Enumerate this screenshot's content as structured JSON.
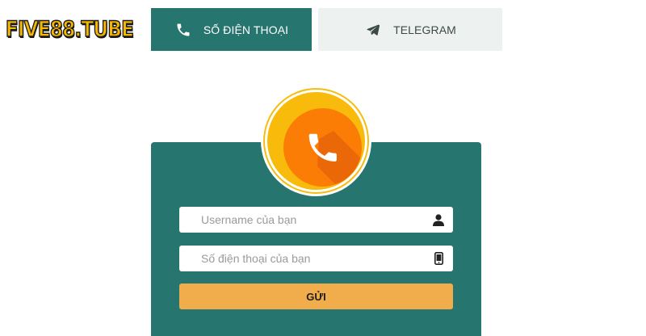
{
  "brand": {
    "logo_text": "FIVE88.TUBE"
  },
  "tabs": [
    {
      "label": "SỐ ĐIỆN THOẠI",
      "icon": "phone-icon",
      "active": true
    },
    {
      "label": "TELEGRAM",
      "icon": "telegram-icon",
      "active": false
    }
  ],
  "badge": {
    "icon": "phone-icon"
  },
  "form": {
    "username": {
      "value": "",
      "placeholder": "Username của bạn",
      "icon": "user-icon"
    },
    "phone": {
      "value": "",
      "placeholder": "Số điện thoại của bạn",
      "icon": "mobile-icon"
    },
    "submit_label": "GỬI"
  },
  "colors": {
    "primary_teal": "#27756f",
    "tab_inactive_bg": "#edf1f0",
    "badge_yellow": "#f8bb0c",
    "badge_orange": "#fb7d06",
    "submit_bg": "#f1ad4b",
    "logo_yellow": "#f5b700"
  }
}
